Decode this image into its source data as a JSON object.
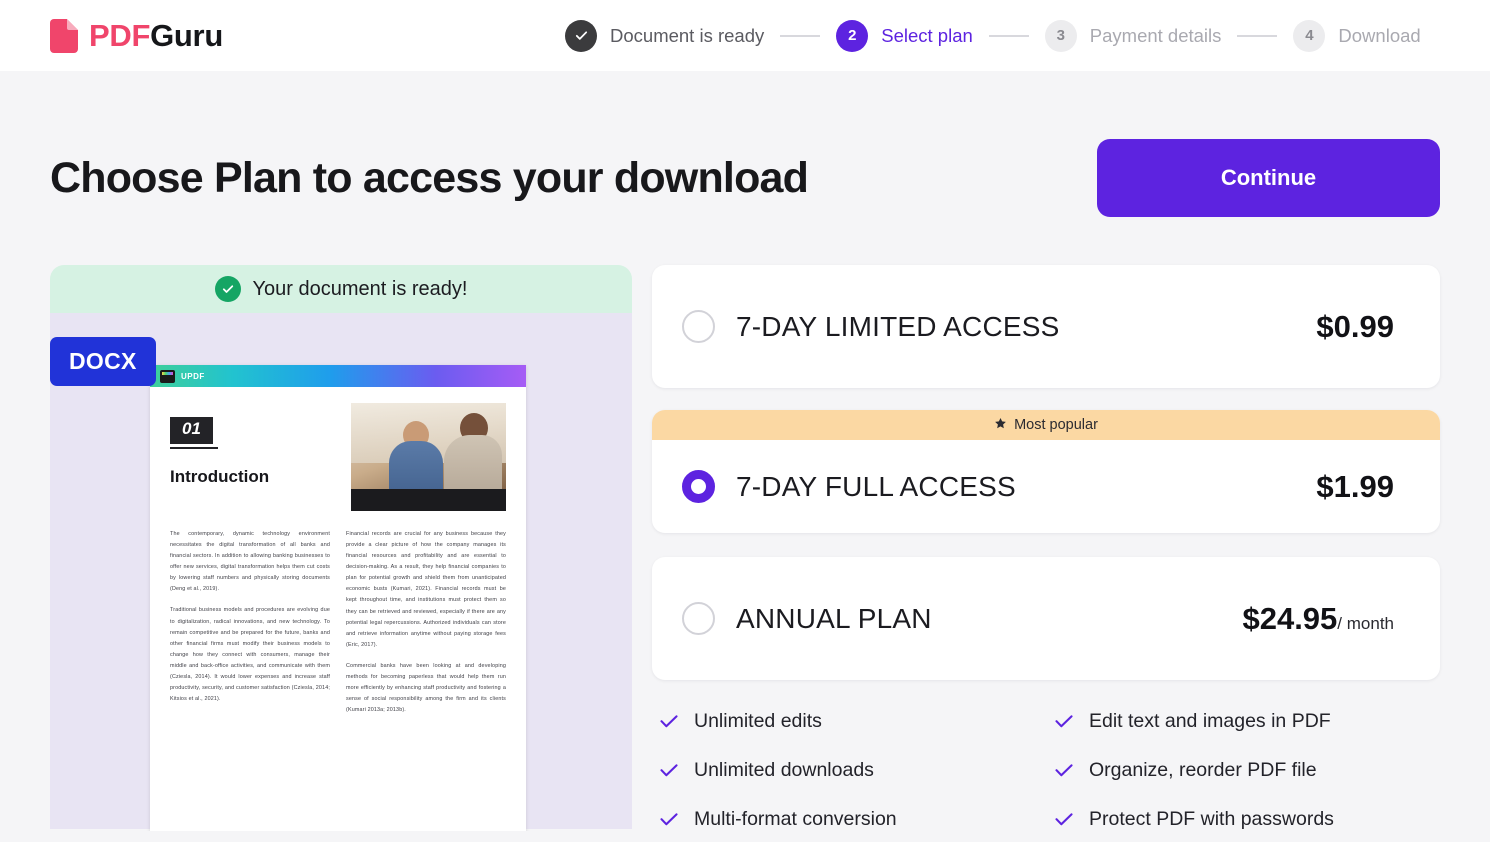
{
  "brand": {
    "pdf": "PDF",
    "guru": "Guru",
    "icon": "pdf-file-icon"
  },
  "stepper": {
    "steps": [
      {
        "marker": "✓",
        "label": "Document is ready",
        "state": "done"
      },
      {
        "marker": "2",
        "label": "Select plan",
        "state": "active"
      },
      {
        "marker": "3",
        "label": "Payment details",
        "state": "idle"
      },
      {
        "marker": "4",
        "label": "Download",
        "state": "idle"
      }
    ]
  },
  "page": {
    "title": "Choose Plan to access your download",
    "continue_label": "Continue",
    "accent_color": "#5d23e0",
    "background_color": "#f5f5f7"
  },
  "document_preview": {
    "ready_banner": "Your document is ready!",
    "ready_icon": "check-circle-icon",
    "format_badge": "DOCX",
    "watermark": "UPDF",
    "section_number": "01",
    "heading": "Introduction",
    "column_left": [
      "The contemporary, dynamic technology environment necessitates the digital transformation of all banks and financial sectors. In addition to allowing banking businesses to offer new services, digital transformation helps them cut costs by lowering staff numbers and physically storing documents (Deng et al., 2019).",
      "Traditional business models and procedures are evolving due to digitalization, radical innovations, and new technology. To remain competitive and be prepared for the future, banks and other financial firms must modify their business models to change how they connect with consumers, manage their middle and back-office activities, and communicate with them (Cziesla, 2014). It would lower expenses and increase staff productivity, security, and customer satisfaction (Cziesla, 2014; Kitsios et al., 2021)."
    ],
    "column_right": [
      "Financial records are crucial for any business because they provide a clear picture of how the company manages its financial resources and profitability and are essential to decision-making. As a result, they help financial companies to plan for potential growth and shield them from unanticipated economic busts (Kumari, 2021). Financial records must be kept throughout time, and institutions must protect them so they can be retrieved and reviewed, especially if there are any potential legal repercussions. Authorized individuals can store and retrieve information anytime without paying storage fees (Eric, 2017).",
      "Commercial banks have been looking at and developing methods for becoming paperless that would help them run more efficiently by enhancing staff productivity and fostering a sense of social responsibility among the firm and its clients (Kumari 2013a; 2013b)."
    ]
  },
  "plans": [
    {
      "name": "7-DAY LIMITED ACCESS",
      "price": "$0.99",
      "per": "",
      "selected": false,
      "banner": null
    },
    {
      "name": "7-DAY FULL ACCESS",
      "price": "$1.99",
      "per": "",
      "selected": true,
      "banner": "Most popular",
      "banner_icon": "star-icon"
    },
    {
      "name": "ANNUAL PLAN",
      "price": "$24.95",
      "per": "/ month",
      "selected": false,
      "banner": null
    }
  ],
  "features": [
    "Unlimited edits",
    "Edit text and images in PDF",
    "Unlimited downloads",
    "Organize, reorder PDF file",
    "Multi-format conversion",
    "Protect PDF with passwords"
  ]
}
